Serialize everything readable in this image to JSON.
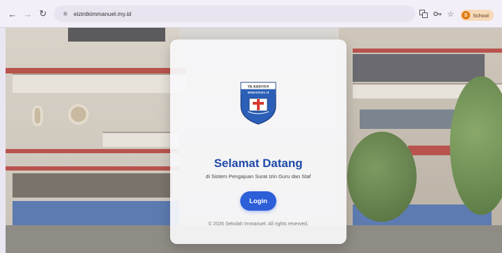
{
  "browser": {
    "url": "eizintkimmanuel.my.id",
    "back_icon": "arrow-left-icon",
    "forward_icon": "arrow-right-icon",
    "reload_icon": "reload-icon",
    "site_info_icon": "tune-icon",
    "profile": {
      "initial": "S",
      "label": "School",
      "color": "#e07a10"
    }
  },
  "logo": {
    "top_text": "TK KRISTEN",
    "name_text": "IMMANUEL II",
    "colors": {
      "shield": "#2b5fb8",
      "cross": "#d43a2f",
      "band": "#ffffff"
    }
  },
  "card": {
    "title": "Selamat Datang",
    "subtitle": "di Sistem Pengajuan Surat Izin Guru dan Staf",
    "login_label": "Login",
    "copyright": "© 2026 Sekolah Immanuel. All rights reserved."
  },
  "colors": {
    "accent": "#2d5fd9",
    "title": "#1f4aa8"
  }
}
